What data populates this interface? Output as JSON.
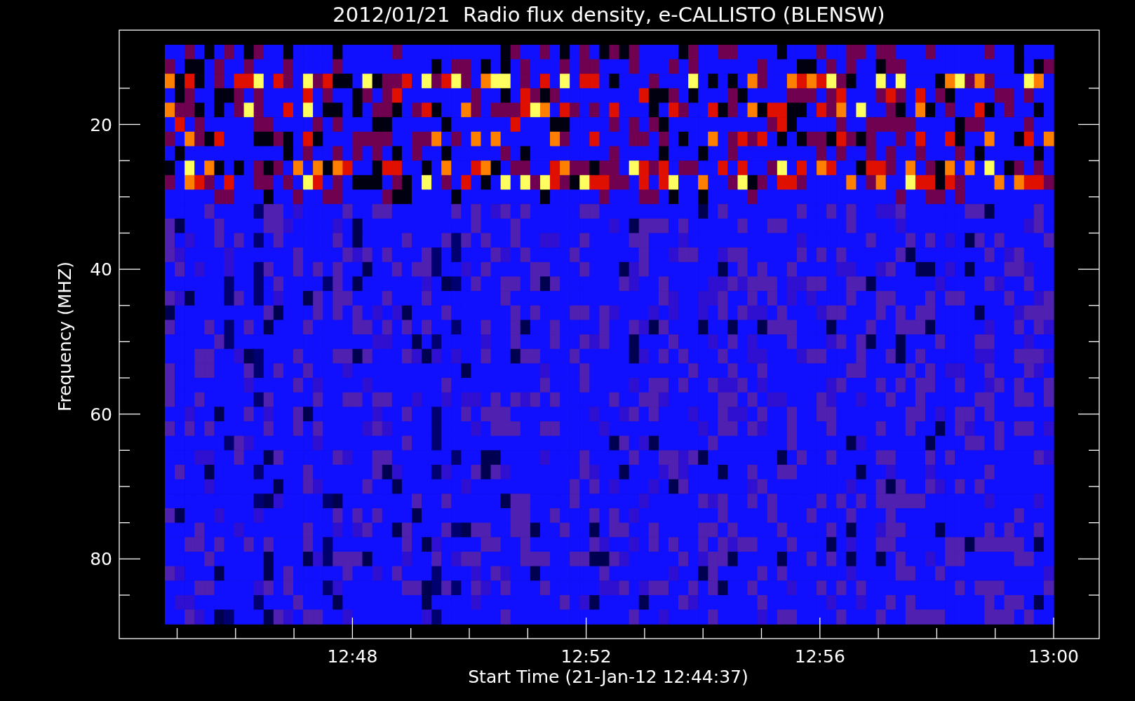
{
  "title": "2012/01/21  Radio flux density, e-CALLISTO (BLENSW)",
  "ylabel": "Frequency (MHZ)",
  "xlabel": "Start Time (21-Jan-12 12:44:37)",
  "yticks": [
    "20",
    "40",
    "60",
    "80"
  ],
  "xticks": [
    "12:48",
    "12:52",
    "12:56",
    "13:00"
  ]
}
